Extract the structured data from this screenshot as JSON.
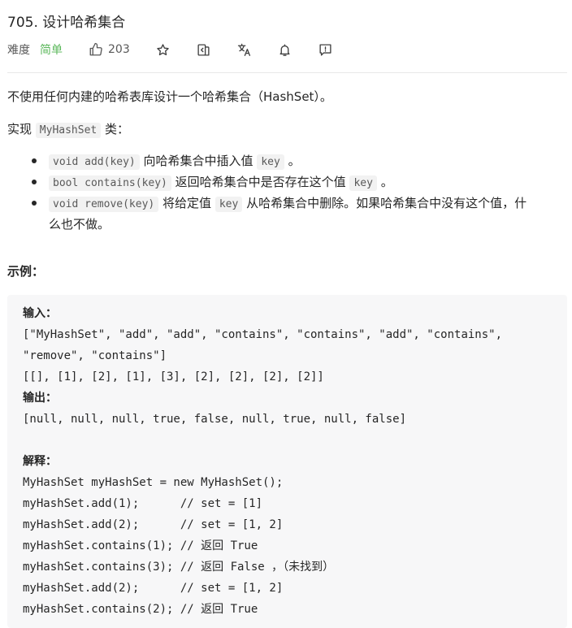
{
  "problem": {
    "title": "705. 设计哈希集合",
    "difficulty_label": "难度",
    "difficulty": "简单",
    "likes": "203"
  },
  "description": {
    "intro": "不使用任何内建的哈希表库设计一个哈希集合（HashSet）。",
    "implement_prefix": "实现",
    "implement_class": "MyHashSet",
    "implement_suffix": "类：",
    "methods": [
      {
        "code": "void add(key)",
        "text": "向哈希集合中插入值",
        "code2": "key",
        "tail": "。"
      },
      {
        "code": "bool contains(key)",
        "text": "返回哈希集合中是否存在这个值",
        "code2": "key",
        "tail": "。"
      },
      {
        "code": "void remove(key)",
        "text": "将给定值",
        "code2": "key",
        "tail": "从哈希集合中删除。如果哈希集合中没有这个值，什",
        "tail2": "么也不做。"
      }
    ]
  },
  "example": {
    "heading": "示例：",
    "input_label": "输入：",
    "input_line1": "[\"MyHashSet\", \"add\", \"add\", \"contains\", \"contains\", \"add\", \"contains\",",
    "input_line2": "\"remove\", \"contains\"]",
    "input_line3": "[[], [1], [2], [1], [3], [2], [2], [2], [2]]",
    "output_label": "输出：",
    "output_line": "[null, null, null, true, false, null, true, null, false]",
    "explain_label": "解释：",
    "explain_lines": [
      "MyHashSet myHashSet = new MyHashSet();",
      "myHashSet.add(1);      // set = [1]",
      "myHashSet.add(2);      // set = [1, 2]",
      "myHashSet.contains(1); // 返回 True",
      "myHashSet.contains(3); // 返回 False ，（未找到）",
      "myHashSet.add(2);      // set = [1, 2]",
      "myHashSet.contains(2); // 返回 True"
    ]
  },
  "icons": [
    "thumbs-up-icon",
    "star-icon",
    "share-icon",
    "translate-icon",
    "bell-icon",
    "feedback-icon"
  ],
  "colors": {
    "difficulty_easy": "#5cb85c",
    "code_bg": "#f7f7f8",
    "inline_code_bg": "#f2f2f2"
  }
}
